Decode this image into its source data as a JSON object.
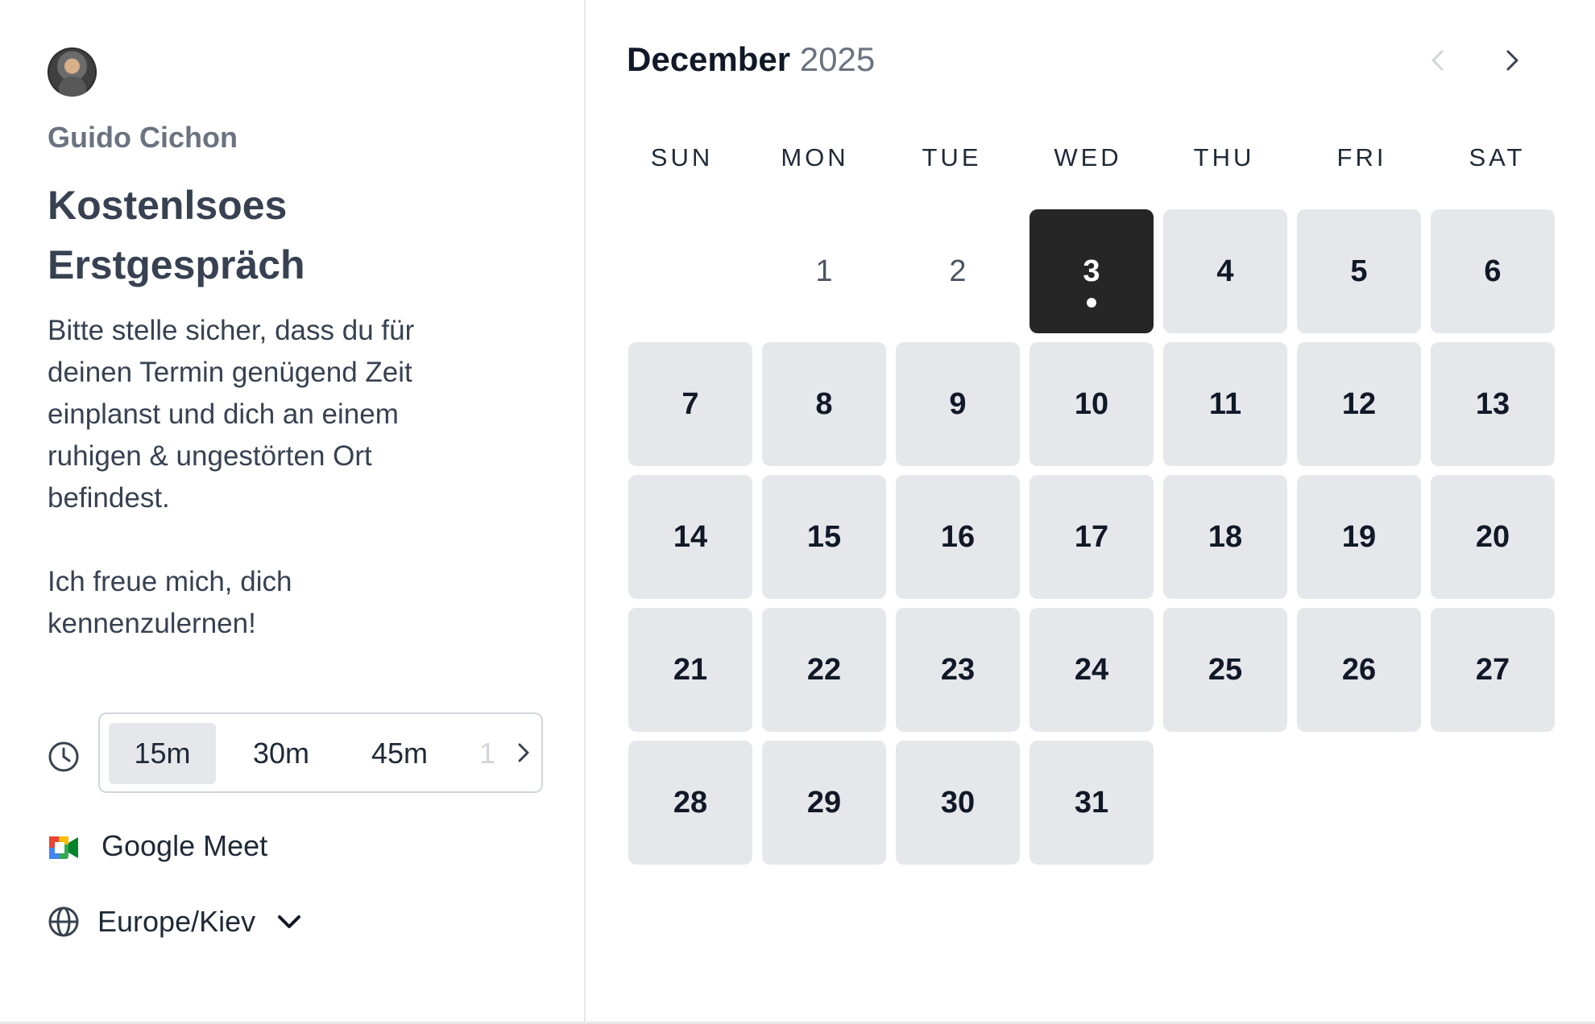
{
  "host": {
    "name": "Guido Cichon",
    "event_title": "Kostenlsoes Erstgespräch",
    "description": "Bitte stelle sicher, dass du für deinen Termin genügend Zeit einplanst und dich an einem ruhigen & ungestörten Ort befindest.\n\nIch freue mich, dich kennenzulernen!"
  },
  "durations": {
    "options": [
      "15m",
      "30m",
      "45m",
      "1"
    ],
    "selected": "15m"
  },
  "location": {
    "label": "Google Meet"
  },
  "timezone": {
    "label": "Europe/Kiev"
  },
  "calendar": {
    "month": "December",
    "year": "2025",
    "weekdays": [
      "SUN",
      "MON",
      "TUE",
      "WED",
      "THU",
      "FRI",
      "SAT"
    ],
    "days": [
      "1",
      "2",
      "3",
      "4",
      "5",
      "6",
      "7",
      "8",
      "9",
      "10",
      "11",
      "12",
      "13",
      "14",
      "15",
      "16",
      "17",
      "18",
      "19",
      "20",
      "21",
      "22",
      "23",
      "24",
      "25",
      "26",
      "27",
      "28",
      "29",
      "30",
      "31"
    ],
    "selected_day": "3",
    "disabled_days": [
      "1",
      "2"
    ]
  },
  "icons": {
    "clock": "clock-icon",
    "meet": "google-meet-icon",
    "globe": "globe-icon",
    "prev": "chevron-left-icon",
    "next": "chevron-right-icon"
  },
  "colors": {
    "selected_day_bg": "#262626",
    "available_day_bg": "#e5e7eb",
    "text": "#1f2937",
    "muted": "#6b7280"
  }
}
